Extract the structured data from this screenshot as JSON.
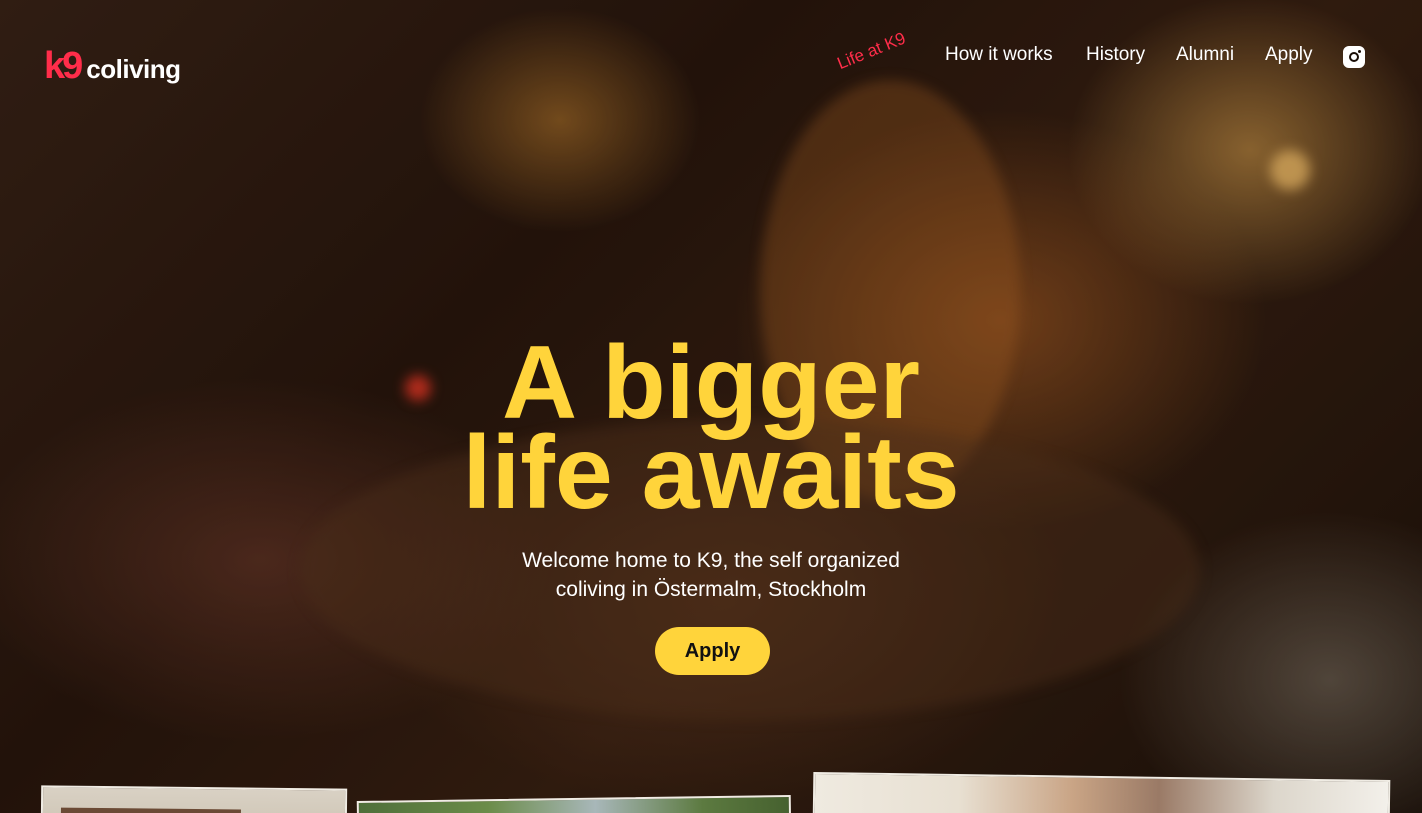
{
  "brand": {
    "mark": "k9",
    "name": "coliving",
    "accent_color": "#ff2d4a"
  },
  "nav": {
    "items": [
      {
        "label": "Life at K9"
      },
      {
        "label": "How it works"
      },
      {
        "label": "History"
      },
      {
        "label": "Alumni"
      },
      {
        "label": "Apply"
      }
    ],
    "instagram_icon": "instagram-icon"
  },
  "hero": {
    "headline_line1": "A bigger",
    "headline_line2": "life awaits",
    "headline_color": "#ffd43b",
    "subtitle_line1": "Welcome home to K9, the self organized",
    "subtitle_line2": "coliving in Östermalm, Stockholm",
    "cta_label": "Apply"
  }
}
